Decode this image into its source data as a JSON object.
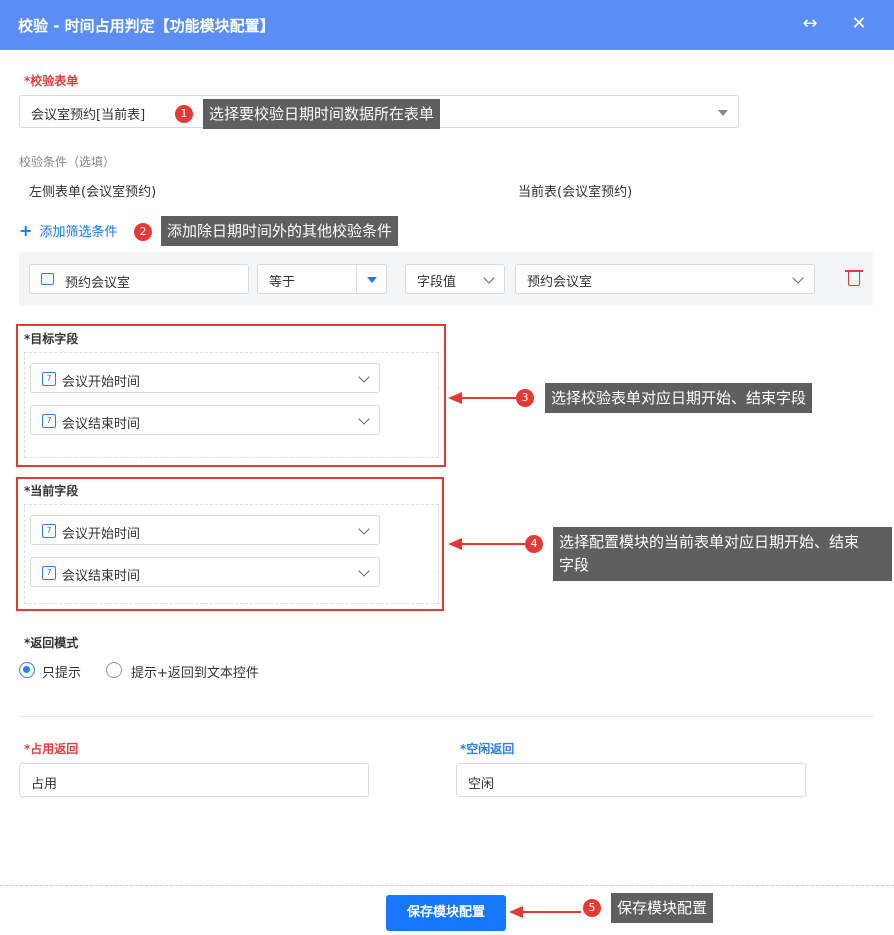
{
  "titlebar": {
    "title": "校验 - 时间占用判定【功能模块配置】",
    "expand_icon": "↔",
    "close_icon": "✕"
  },
  "form": {
    "check_form_label": "*校验表单",
    "check_form_value": "会议室预约[当前表]",
    "condition_label": "校验条件（选填）",
    "left_form": "左侧表单(会议室预约)",
    "current_table": "当前表(会议室预约)",
    "add_filter": "添加筛选条件",
    "filter": {
      "field": "预约会议室",
      "operator": "等于",
      "value_type": "字段值",
      "value": "预约会议室"
    },
    "target_label": "*目标字段",
    "target_fields": [
      "会议开始时间",
      "会议结束时间"
    ],
    "current_label": "*当前字段",
    "current_fields": [
      "会议开始时间",
      "会议结束时间"
    ],
    "return_mode_label": "*返回模式",
    "return_modes": [
      "只提示",
      "提示+返回到文本控件"
    ],
    "occupied_label": "*占用返回",
    "occupied_value": "占用",
    "free_label": "*空闲返回",
    "free_value": "空闲",
    "save_button": "保存模块配置"
  },
  "annotations": {
    "badges": [
      "1",
      "2",
      "3",
      "4",
      "5"
    ],
    "tips": [
      "选择要校验日期时间数据所在表单",
      "添加除日期时间外的其他校验条件",
      "选择校验表单对应日期开始、结束字段",
      "选择配置模块的当前表单对应日期开始、结束",
      "字段",
      "保存模块配置"
    ]
  },
  "colors": {
    "header": "#5b8ef5",
    "primary": "#1677ff",
    "danger": "#e53935"
  }
}
